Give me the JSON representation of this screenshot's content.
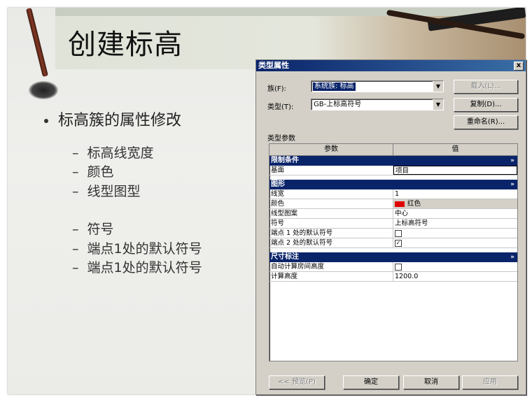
{
  "slide": {
    "title": "创建标高",
    "bullet": "标高簇的属性修改",
    "subitems": [
      "标高线宽度",
      "颜色",
      "线型图型",
      "符号",
      "端点1处的默认符号",
      "端点1处的默认符号"
    ],
    "dash": "–"
  },
  "dialog": {
    "title": "类型属性",
    "close": "x",
    "family_label": "族(F):",
    "family_value": "系统族: 标高",
    "type_label": "类型(T):",
    "type_value": "GB-上标高符号",
    "load_button": "载入(L)...",
    "duplicate_button": "复制(D)...",
    "rename_button": "重命名(R)...",
    "type_params_label": "类型参数",
    "columns": {
      "param": "参数",
      "value": "值"
    },
    "groups": [
      {
        "name": "限制条件",
        "rows": [
          {
            "param": "基面",
            "value": "项目"
          }
        ]
      },
      {
        "name": "图形",
        "rows": [
          {
            "param": "线宽",
            "value": "1"
          },
          {
            "param": "颜色",
            "value": "红色"
          },
          {
            "param": "线型图案",
            "value": "中心"
          },
          {
            "param": "符号",
            "value": "上标高符号"
          },
          {
            "param": "端点 1 处的默认符号",
            "value": ""
          },
          {
            "param": "端点 2 处的默认符号",
            "value": "✓"
          }
        ]
      },
      {
        "name": "尺寸标注",
        "rows": [
          {
            "param": "自动计算房间高度",
            "value": ""
          },
          {
            "param": "计算高度",
            "value": "1200.0"
          }
        ]
      }
    ],
    "chevron": "»",
    "preview_button": "<< 预览(P)",
    "ok_button": "确定",
    "cancel_button": "取消",
    "apply_button": "应用",
    "colors": {
      "title_bar": "#0a246a",
      "group_header": "#0a246a",
      "color_swatch": "#e00000",
      "dialog_bg": "#d4d0c8"
    }
  }
}
